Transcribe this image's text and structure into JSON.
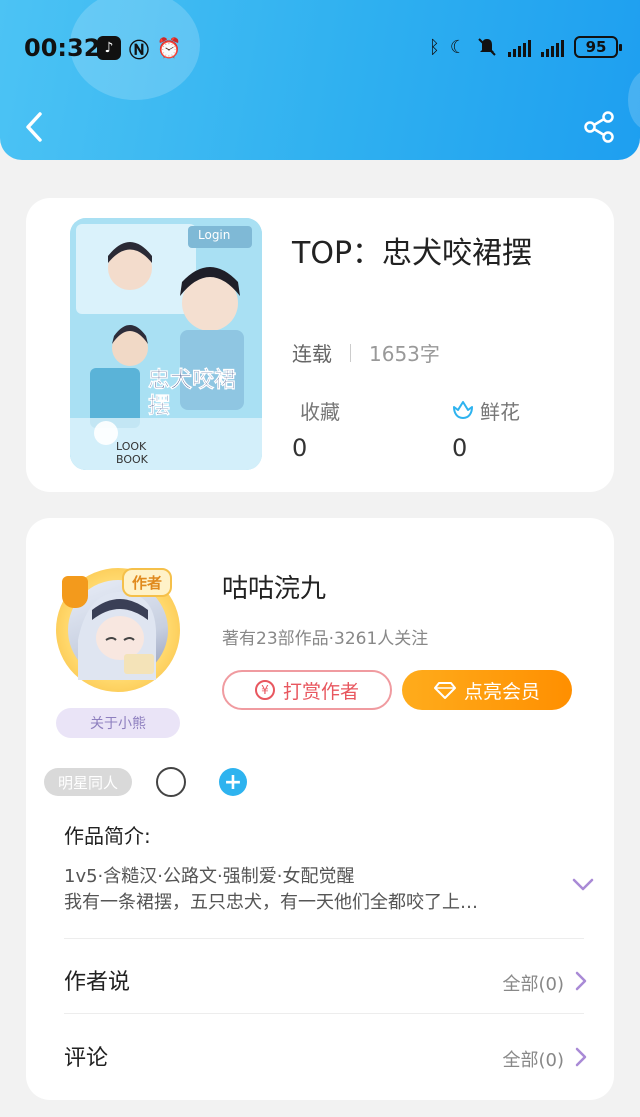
{
  "status_bar": {
    "time": "00:32",
    "app_icons": [
      "tiktok-icon",
      "nfc-icon",
      "alarm-icon"
    ],
    "right_icons": [
      "bluetooth-icon",
      "moon-icon",
      "mute-icon",
      "signal-icon",
      "signal-icon"
    ],
    "battery": "95"
  },
  "header": {
    "back_icon": "chevron-left-icon",
    "share_icon": "share-icon",
    "gradient_start": "#4cc3f4",
    "gradient_end": "#1e9ff0"
  },
  "book": {
    "title": "TOP：忠犬咬裙摆",
    "status": "连载",
    "word_count": "1653字",
    "favorites_label": "收藏",
    "favorites_count": "0",
    "flowers_label": "鲜花",
    "flowers_count": "0",
    "cover_text": "忠犬咬裙摆",
    "cover_login": "Login",
    "cover_lookbook": "LOOK BOOK"
  },
  "author": {
    "name": "咕咕浣九",
    "stats": "著有23部作品·3261人关注",
    "badge": "作者",
    "about_label": "关于小熊",
    "reward_button": "打赏作者",
    "vip_button": "点亮会员"
  },
  "tags": {
    "tag1": "明星同人",
    "add_symbol": "+"
  },
  "intro": {
    "title": "作品简介:",
    "line1": "1v5·含糙汉·公路文·强制爱·女配觉醒",
    "line2": "我有一条裙摆，五只忠犬，有一天他们全都咬了上…"
  },
  "sections": {
    "author_say_label": "作者说",
    "author_say_count": "全部(0)",
    "comments_label": "评论",
    "comments_count": "全部(0)"
  },
  "colors": {
    "accent_blue": "#2eb3ef",
    "reward_red": "#e8575f",
    "vip_orange": "#ff8f00",
    "chevron_purple": "#a98ad6"
  }
}
